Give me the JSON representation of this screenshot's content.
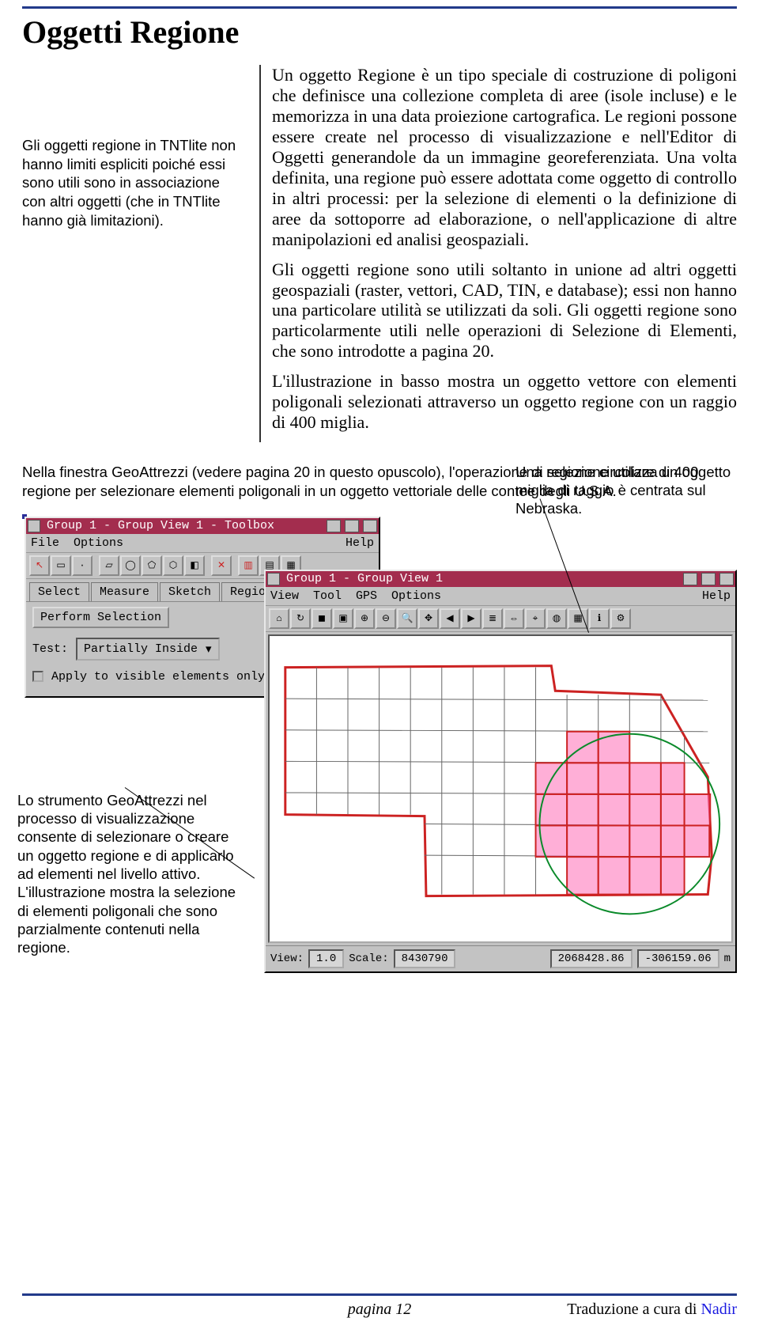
{
  "title": "Oggetti Regione",
  "side_note": "Gli oggetti regione in TNTlite non hanno limiti espliciti poiché essi sono utili sono in associazione con altri oggetti (che in TNTlite hanno già limitazioni).",
  "paragraphs": {
    "p1": "Un oggetto Regione è un tipo speciale di costruzione di poligoni che definisce una collezione completa di aree (isole incluse) e le memorizza in una data proiezione cartografica. Le regioni possone essere create nel processo di visualizzazione e nell'Editor di Oggetti generandole da un immagine georeferenziata. Una volta definita, una regione può essere adottata come oggetto di controllo in altri processi: per la selezione di elementi o la definizione di aree da sottoporre ad elaborazione, o nell'applicazione di altre manipolazioni ed analisi geospaziali.",
    "p2": "Gli oggetti regione sono utili soltanto in unione ad altri oggetti geospaziali (raster, vettori, CAD, TIN, e database); essi non hanno una particolare utilità se utilizzati da soli. Gli oggetti regione sono particolarmente utili nelle operazioni di Selezione di Elementi, che sono introdotte a pagina 20.",
    "p3": "L'illustrazione in basso mostra un oggetto vettore con elementi poligonali selezionati attraverso un oggetto regione con un raggio di 400 miglia."
  },
  "caption_after": "Nella finestra GeoAttrezzi (vedere pagina 20 in questo opuscolo), l'operazione di selezione utilizza un oggetto regione per selezionare elementi poligonali in un oggetto vettoriale delle contee degli U.S.A.",
  "toolbox": {
    "title": "Group 1 - Group View 1 - Toolbox",
    "menu": {
      "file": "File",
      "options": "Options",
      "help": "Help"
    },
    "tabs": {
      "select": "Select",
      "measure": "Measure",
      "sketch": "Sketch",
      "region": "Region"
    },
    "perform": "Perform Selection",
    "test_label": "Test:",
    "test_value": "Partially Inside",
    "apply": "Apply to visible elements only"
  },
  "viewer": {
    "title": "Group 1 - Group View 1",
    "menu": {
      "view": "View",
      "tool": "Tool",
      "gps": "GPS",
      "options": "Options",
      "help": "Help"
    },
    "status": {
      "view_label": "View:",
      "view_value": "1.0",
      "scale_label": "Scale:",
      "scale_value": "8430790",
      "coord_x": "2068428.86",
      "coord_y": "-306159.06",
      "unit": "m"
    }
  },
  "callout_top": "Una regione circolare di 400 miglia di raggio è centrata sul Nebraska.",
  "callout_left": "Lo strumento GeoAttrezzi nel processo di visualizzazione consente di selezionare o creare un oggetto regione e di applicarlo ad elementi nel livello attivo. L'illustrazione mostra la selezione di elementi poligonali che sono parzialmente contenuti nella regione.",
  "footer": {
    "page_label": "pagina 12",
    "trad_text": "Traduzione a cura di ",
    "trad_link": "Nadir"
  }
}
